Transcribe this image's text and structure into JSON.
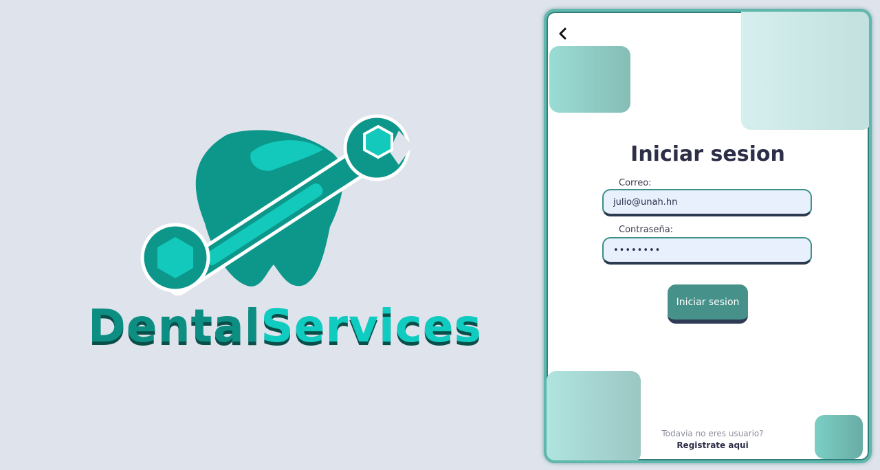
{
  "logo": {
    "text_part1": "Dental",
    "text_part2": "Services",
    "icon": "tooth-wrench-icon"
  },
  "login": {
    "back_icon": "chevron-left-icon",
    "title": "Iniciar sesion",
    "email_label": "Correo:",
    "email_value": "julio@unah.hn",
    "password_label": "Contraseña:",
    "password_value": "••••••••",
    "submit_label": "Iniciar sesion",
    "register_question": "Todavia no eres usuario?",
    "register_link": "Registrate aqui"
  },
  "colors": {
    "background": "#dfe3ec",
    "brand_dark": "#0c8f82",
    "brand_light": "#10cbbf",
    "button": "#46918a",
    "input_bg": "#e8f0fe"
  }
}
